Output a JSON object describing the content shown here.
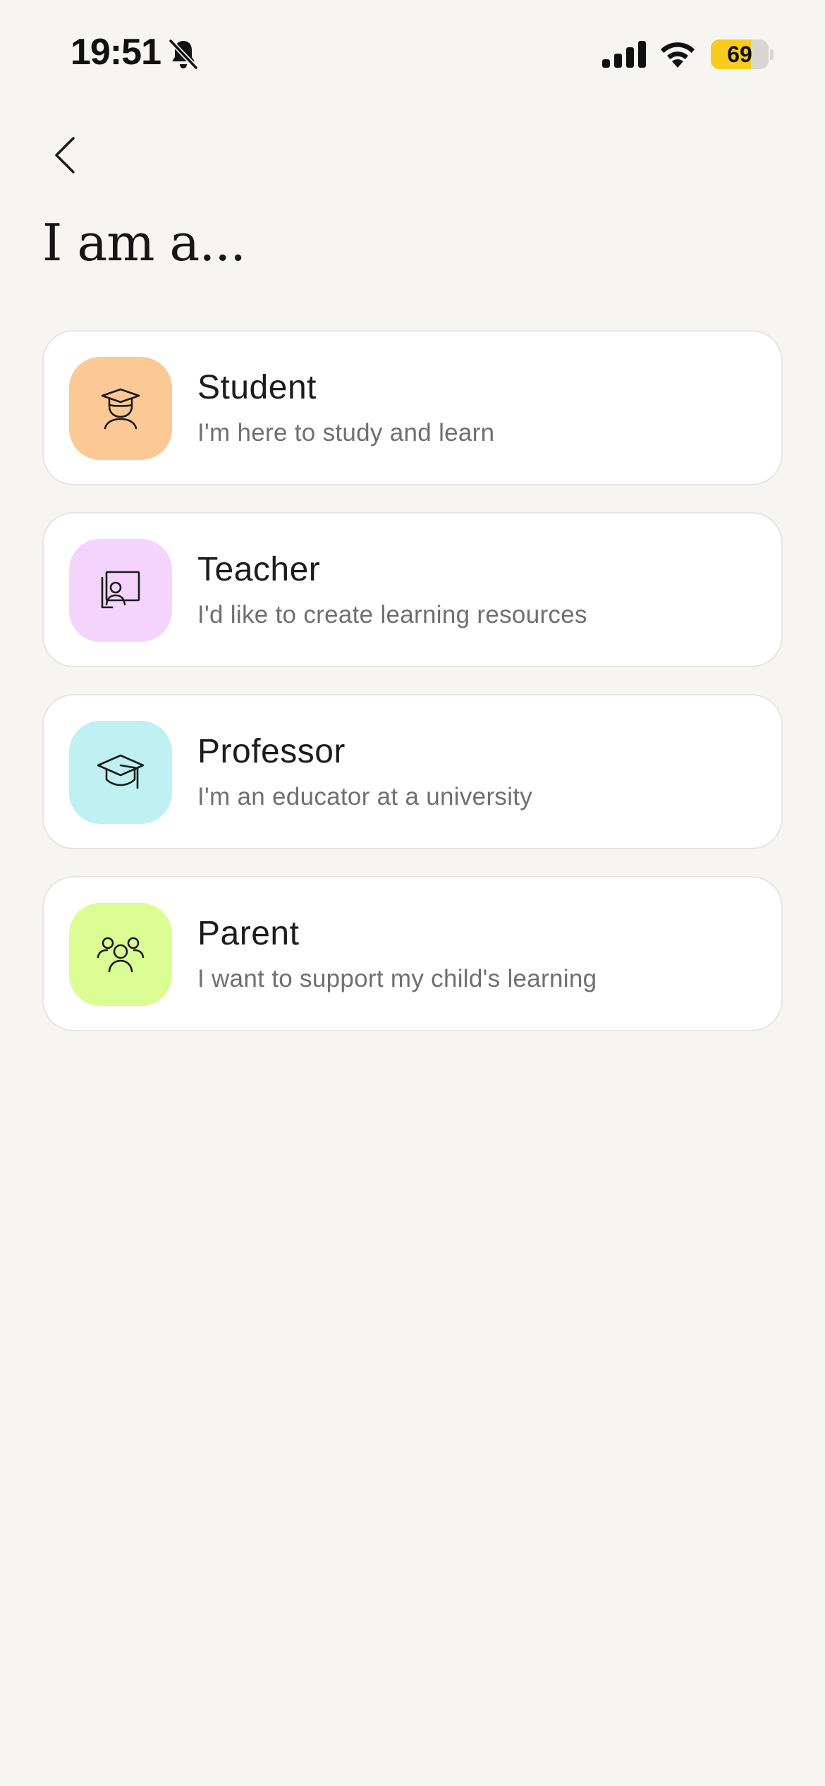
{
  "status_bar": {
    "time": "19:51",
    "battery_level": "69",
    "battery_percent": 69,
    "battery_color": "#f7cc1e",
    "icons": [
      "bell-slash-icon",
      "cellular-signal-icon",
      "wifi-icon",
      "battery-icon"
    ]
  },
  "nav": {
    "back_icon": "chevron-left-icon"
  },
  "page": {
    "title": "I am a..."
  },
  "roles": [
    {
      "id": "student",
      "title": "Student",
      "description": "I'm here to study and learn",
      "icon": "student-icon",
      "tile_color": "#fcc896"
    },
    {
      "id": "teacher",
      "title": "Teacher",
      "description": "I'd like to create learning resources",
      "icon": "presentation-board-icon",
      "tile_color": "#f4d4fc"
    },
    {
      "id": "professor",
      "title": "Professor",
      "description": "I'm an educator at a university",
      "icon": "graduation-cap-icon",
      "tile_color": "#bff0f2"
    },
    {
      "id": "parent",
      "title": "Parent",
      "description": "I want to support my child's learning",
      "icon": "family-icon",
      "tile_color": "#dbfd93"
    }
  ]
}
